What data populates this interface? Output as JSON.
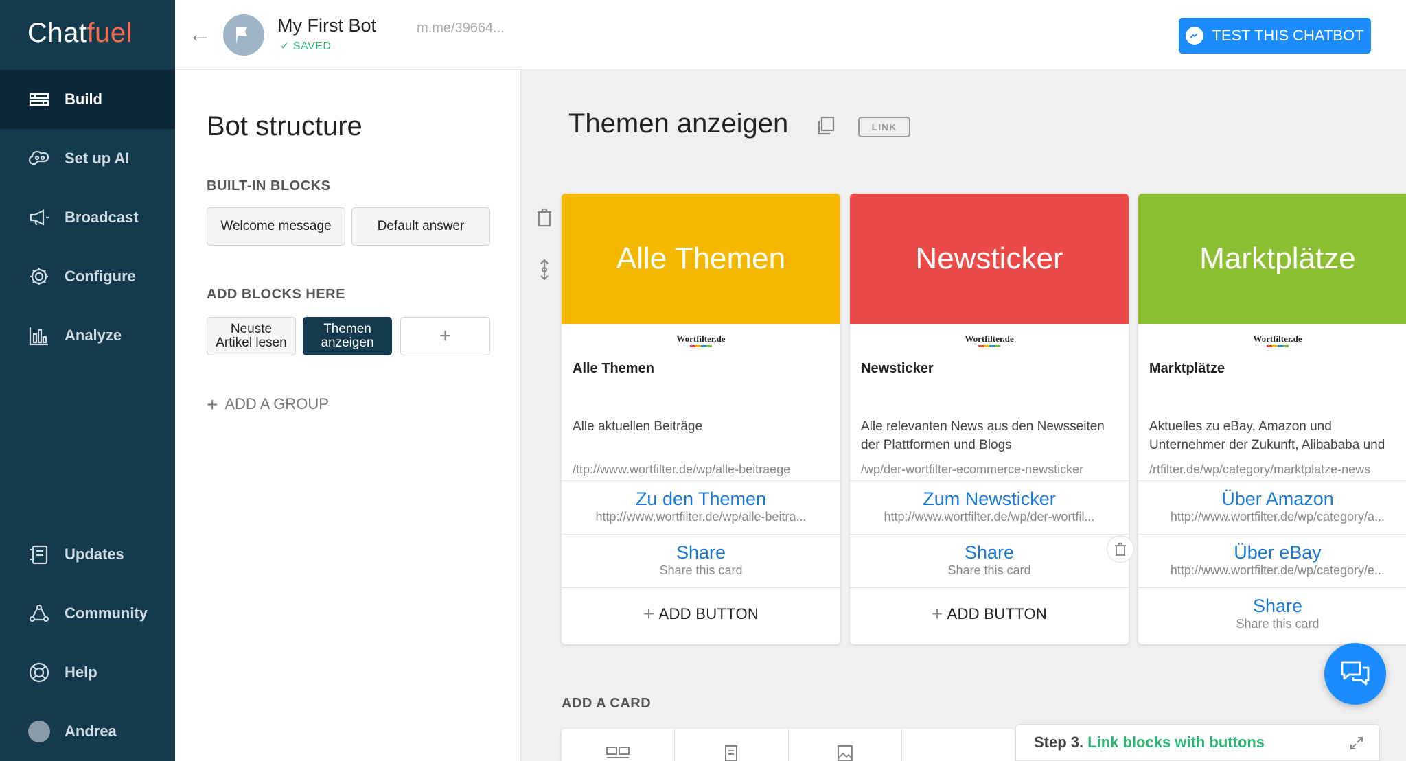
{
  "app": {
    "logo_main": "Chat",
    "logo_accent": "fuel"
  },
  "sidebar": {
    "items": [
      {
        "label": "Build",
        "icon": "build-icon"
      },
      {
        "label": "Set up AI",
        "icon": "brain-icon"
      },
      {
        "label": "Broadcast",
        "icon": "megaphone-icon"
      },
      {
        "label": "Configure",
        "icon": "gear-icon"
      },
      {
        "label": "Analyze",
        "icon": "bar-chart-icon"
      },
      {
        "label": "Updates",
        "icon": "updates-icon"
      },
      {
        "label": "Community",
        "icon": "community-icon"
      },
      {
        "label": "Help",
        "icon": "lifebuoy-icon"
      },
      {
        "label": "Andrea",
        "icon": "avatar"
      }
    ]
  },
  "topbar": {
    "bot_name": "My First Bot",
    "status": "SAVED",
    "bot_link": "m.me/39664...",
    "test_button": "TEST THIS CHATBOT"
  },
  "structure": {
    "title": "Bot structure",
    "builtin_label": "BUILT-IN BLOCKS",
    "builtin_blocks": [
      "Welcome message",
      "Default answer"
    ],
    "add_label": "ADD BLOCKS HERE",
    "blocks": [
      "Neuste Artikel lesen",
      "Themen anzeigen"
    ],
    "add_plus": "+",
    "add_group": "ADD A GROUP"
  },
  "canvas": {
    "block_title": "Themen anzeigen",
    "link_tag": "LINK",
    "add_button_label": "ADD BUTTON",
    "add_card_label": "ADD A CARD",
    "cards": [
      {
        "color": "#f5b800",
        "header": "Alle Themen",
        "logo": "Wortfilter.de",
        "title": "Alle Themen",
        "subtitle": "Alle aktuellen Beiträge",
        "url": "ttp://www.wortfilter.de/wp/alle-beitraege/",
        "buttons": [
          {
            "label": "Zu den Themen",
            "sub": "http://www.wortfilter.de/wp/alle-beitra..."
          },
          {
            "label": "Share",
            "sub": "Share this card"
          }
        ]
      },
      {
        "color": "#ec4a48",
        "header": "Newsticker",
        "logo": "Wortfilter.de",
        "title": "Newsticker",
        "subtitle": "Alle relevanten News aus den Newsseiten der Plattformen und Blogs",
        "url": "wp/der-wortfilter-ecommerce-newsticker/",
        "buttons": [
          {
            "label": "Zum Newsticker",
            "sub": "http://www.wortfilter.de/wp/der-wortfil..."
          },
          {
            "label": "Share",
            "sub": "Share this card"
          }
        ]
      },
      {
        "color": "#8bbf31",
        "header": "Marktplätze",
        "logo": "Wortfilter.de",
        "title": "Marktplätze",
        "subtitle": "Aktuelles zu eBay, Amazon und Unternehmer der Zukunft, Alibababa und",
        "url": "rtfilter.de/wp/category/marktplatze-news/",
        "buttons": [
          {
            "label": "Über Amazon",
            "sub": "http://www.wortfilter.de/wp/category/a..."
          },
          {
            "label": "Über eBay",
            "sub": "http://www.wortfilter.de/wp/category/e..."
          },
          {
            "label": "Share",
            "sub": "Share this card"
          }
        ]
      }
    ]
  },
  "onboarding": {
    "step": "Step 3.",
    "text": "Link blocks with buttons"
  }
}
